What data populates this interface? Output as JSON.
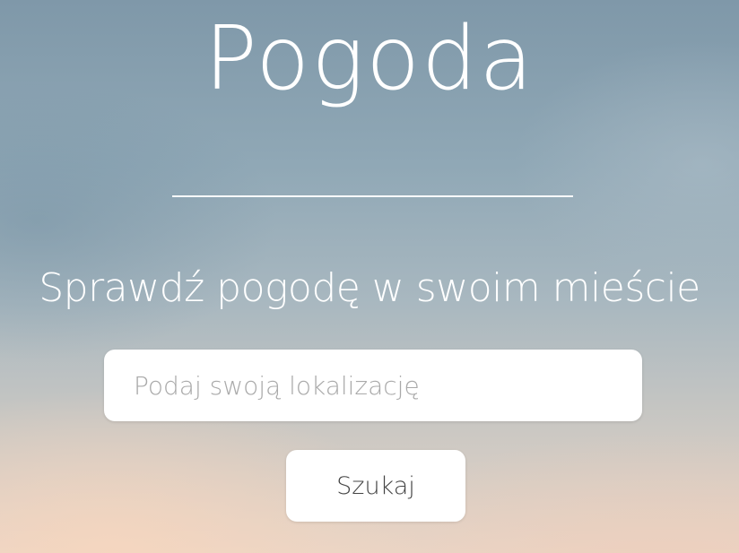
{
  "header": {
    "title": "Pogoda"
  },
  "main": {
    "subtitle": "Sprawdź pogodę w swoim mieście",
    "search": {
      "placeholder": "Podaj swoją lokalizację",
      "value": "",
      "button_label": "Szukaj"
    }
  },
  "colors": {
    "text": "#ffffff",
    "input_background": "#ffffff",
    "placeholder": "#a9a9a9",
    "button_text": "#444444"
  }
}
